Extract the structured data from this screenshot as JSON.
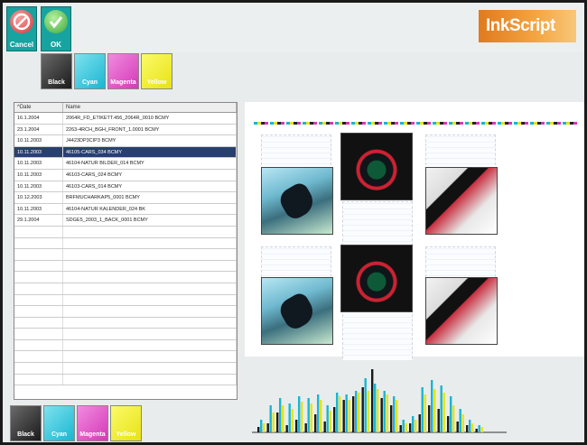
{
  "toolbar": {
    "cancel_label": "Cancel",
    "ok_label": "OK"
  },
  "logo": {
    "text": "InkScript"
  },
  "color_buttons": {
    "top": [
      {
        "label": "Black",
        "color": "#1a1a1a"
      },
      {
        "label": "Cyan",
        "color": "#18b6d2"
      },
      {
        "label": "Magenta",
        "color": "#d538b6"
      },
      {
        "label": "Yellow",
        "color": "#e8e214"
      }
    ],
    "bottom": [
      {
        "label": "Black",
        "color": "#1a1a1a"
      },
      {
        "label": "Cyan",
        "color": "#18b6d2"
      },
      {
        "label": "Magenta",
        "color": "#d538b6"
      },
      {
        "label": "Yellow",
        "color": "#e8e214"
      }
    ]
  },
  "file_list": {
    "columns": [
      "^Date",
      "Name"
    ],
    "rows": [
      {
        "date": "16.1.2004",
        "name": "2064R_FD_ETIKETT.456_2064R_0010 BCMY",
        "selected": false
      },
      {
        "date": "23.1.2004",
        "name": "2263-4RCH_BGH_FRONT_1.0001 BCMY",
        "selected": false
      },
      {
        "date": "10.11.2003",
        "name": "J4423DP3CIP3 BCMY",
        "selected": false
      },
      {
        "date": "10.11.2003",
        "name": "46105-CARS_034 BCMY",
        "selected": true
      },
      {
        "date": "10.11.2003",
        "name": "46104-NATUR BILDER_014 BCMY",
        "selected": false
      },
      {
        "date": "10.11.2003",
        "name": "46103-CARS_024 BCMY",
        "selected": false
      },
      {
        "date": "10.11.2003",
        "name": "46103-CARS_014 BCMY",
        "selected": false
      },
      {
        "date": "10.12.2003",
        "name": "BRFMUCHARKAP5_0001 BCMY",
        "selected": false
      },
      {
        "date": "10.11.2003",
        "name": "46104-NATUR KALENDER_024 BK",
        "selected": false
      },
      {
        "date": "29.1.2004",
        "name": "SDGE5_2003_1_BACK_0001 BCMY",
        "selected": false
      }
    ]
  },
  "histogram": {
    "series": [
      {
        "color": "#1a1a1a"
      },
      {
        "color": "#18b6d2"
      },
      {
        "color": "#e8e214"
      }
    ],
    "bars": [
      [
        6,
        14,
        10
      ],
      [
        10,
        30,
        22
      ],
      [
        22,
        38,
        30
      ],
      [
        8,
        32,
        26
      ],
      [
        14,
        40,
        34
      ],
      [
        10,
        38,
        32
      ],
      [
        20,
        42,
        36
      ],
      [
        12,
        30,
        24
      ],
      [
        28,
        44,
        40
      ],
      [
        36,
        42,
        36
      ],
      [
        40,
        46,
        44
      ],
      [
        50,
        60,
        46
      ],
      [
        70,
        54,
        48
      ],
      [
        38,
        46,
        42
      ],
      [
        30,
        40,
        36
      ],
      [
        8,
        14,
        10
      ],
      [
        10,
        18,
        14
      ],
      [
        20,
        50,
        42
      ],
      [
        30,
        58,
        48
      ],
      [
        26,
        52,
        44
      ],
      [
        18,
        40,
        30
      ],
      [
        12,
        26,
        20
      ],
      [
        8,
        14,
        10
      ],
      [
        4,
        8,
        6
      ]
    ]
  }
}
